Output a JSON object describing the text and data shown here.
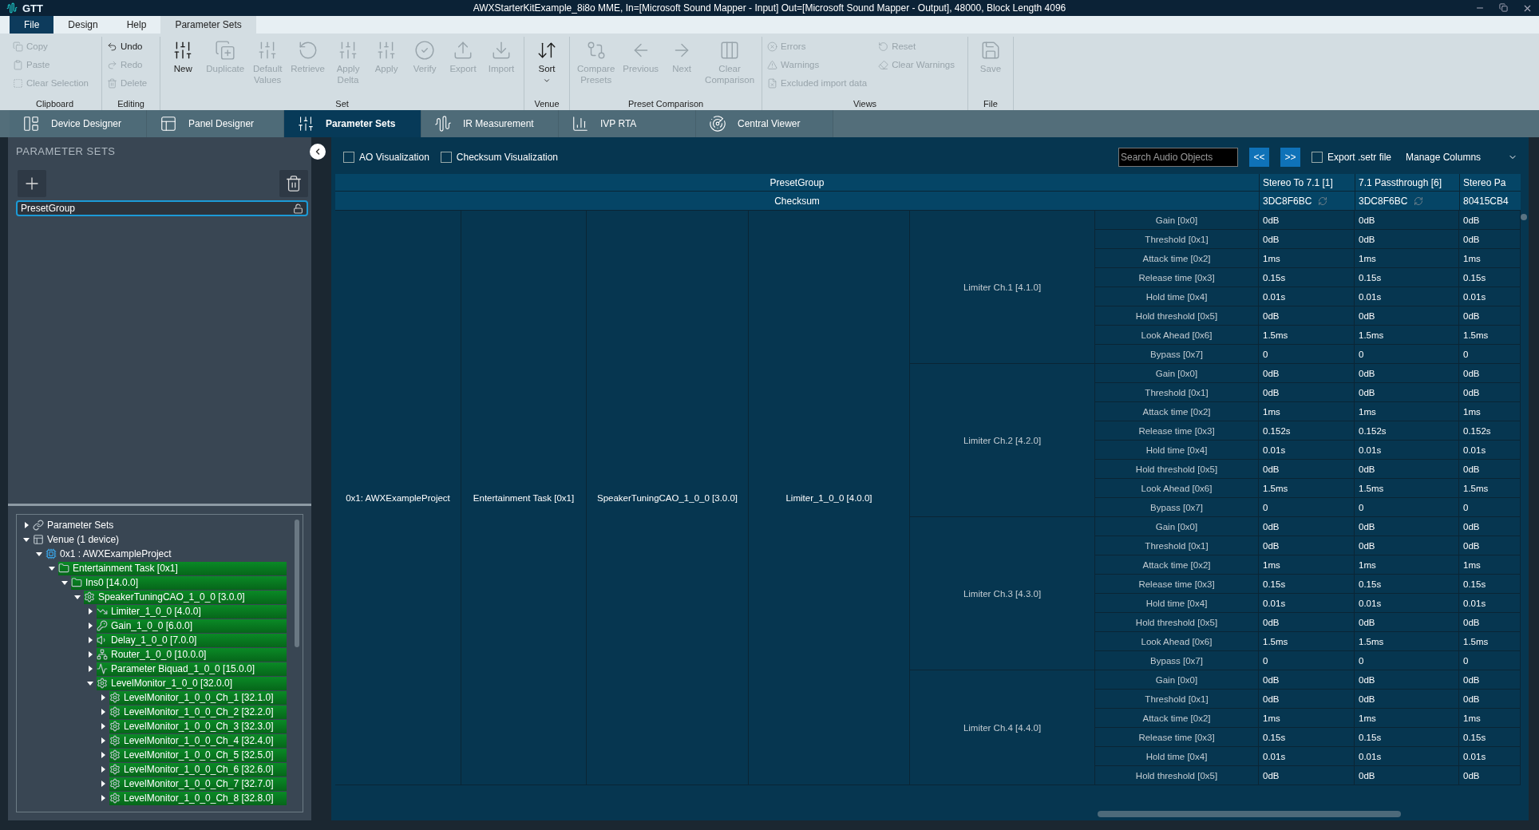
{
  "app_name": "GTT",
  "window": {
    "title": "AWXStarterKitExample_8i8o MME, In=[Microsoft Sound Mapper - Input] Out=[Microsoft Sound Mapper - Output], 48000, Block Length 4096"
  },
  "file_button": "File",
  "menu_tabs": [
    {
      "label": "Design",
      "selected": false
    },
    {
      "label": "Help",
      "selected": false
    },
    {
      "label": "Parameter Sets",
      "selected": true
    }
  ],
  "ribbon_groups": [
    {
      "label": "Clipboard",
      "columns": [
        [
          {
            "label": "Copy",
            "disabled": true
          },
          {
            "label": "Paste",
            "disabled": true
          },
          {
            "label": "Clear Selection",
            "disabled": true
          }
        ]
      ]
    },
    {
      "label": "Editing",
      "columns": [
        [
          {
            "label": "Undo",
            "disabled": false
          },
          {
            "label": "Redo",
            "disabled": true
          },
          {
            "label": "Delete",
            "disabled": true
          }
        ]
      ]
    },
    {
      "label": "Set",
      "items": [
        {
          "label": "New",
          "disabled": false
        },
        {
          "label": "Duplicate",
          "disabled": true
        },
        {
          "label": "Default\nValues",
          "disabled": true
        },
        {
          "label": "Retrieve",
          "disabled": true
        },
        {
          "label": "Apply\nDelta",
          "disabled": true
        },
        {
          "label": "Apply",
          "disabled": true
        },
        {
          "label": "Verify",
          "disabled": true
        },
        {
          "label": "Export",
          "disabled": true
        },
        {
          "label": "Import",
          "disabled": true
        }
      ]
    },
    {
      "label": "Venue",
      "items": [
        {
          "label": "Sort",
          "disabled": false,
          "dropdown": true
        }
      ]
    },
    {
      "label": "Preset Comparison",
      "items": [
        {
          "label": "Compare\nPresets",
          "disabled": true
        },
        {
          "label": "Previous",
          "disabled": true
        },
        {
          "label": "Next",
          "disabled": true
        },
        {
          "label": "Clear\nComparison",
          "disabled": true
        }
      ]
    },
    {
      "label": "Views",
      "columns": [
        [
          {
            "label": "Errors",
            "disabled": true
          },
          {
            "label": "Warnings",
            "disabled": true
          },
          {
            "label": "Excluded import data",
            "disabled": true
          }
        ],
        [
          {
            "label": "Reset",
            "disabled": true
          },
          {
            "label": "Clear Warnings",
            "disabled": true
          }
        ]
      ]
    },
    {
      "label": "File",
      "items": [
        {
          "label": "Save",
          "disabled": true
        }
      ]
    }
  ],
  "module_tabs": [
    {
      "label": "Device Designer",
      "selected": false
    },
    {
      "label": "Panel Designer",
      "selected": false
    },
    {
      "label": "Parameter Sets",
      "selected": true
    },
    {
      "label": "IR Measurement",
      "selected": false
    },
    {
      "label": "IVP RTA",
      "selected": false
    },
    {
      "label": "Central Viewer",
      "selected": false
    }
  ],
  "sidebar": {
    "title": "PARAMETER SETS",
    "sets": [
      {
        "label": "PresetGroup",
        "selected": true,
        "locked": false
      }
    ],
    "tree": [
      {
        "label": "Parameter Sets",
        "kind": "link",
        "expanded": false,
        "highlighted": false
      },
      {
        "label": "Venue (1 device)",
        "kind": "venue",
        "expanded": true,
        "highlighted": false,
        "children": [
          {
            "label": "0x1 : AWXExampleProject",
            "kind": "device",
            "expanded": true,
            "highlighted": false,
            "children": [
              {
                "label": "Entertainment Task [0x1]",
                "kind": "folder",
                "expanded": true,
                "highlighted": true,
                "children": [
                  {
                    "label": "Ins0 [14.0.0]",
                    "kind": "folder",
                    "expanded": true,
                    "highlighted": true,
                    "children": [
                      {
                        "label": "SpeakerTuningCAO_1_0_0 [3.0.0]",
                        "kind": "gear",
                        "expanded": true,
                        "highlighted": true,
                        "children": [
                          {
                            "label": "Limiter_1_0_0 [4.0.0]",
                            "kind": "limiter",
                            "expanded": false,
                            "highlighted": true
                          },
                          {
                            "label": "Gain_1_0_0 [6.0.0]",
                            "kind": "key",
                            "expanded": false,
                            "highlighted": true
                          },
                          {
                            "label": "Delay_1_0_0 [7.0.0]",
                            "kind": "speaker",
                            "expanded": false,
                            "highlighted": true
                          },
                          {
                            "label": "Router_1_0_0 [10.0.0]",
                            "kind": "router",
                            "expanded": false,
                            "highlighted": true
                          },
                          {
                            "label": "Parameter Biquad_1_0_0 [15.0.0]",
                            "kind": "biquad",
                            "expanded": false,
                            "highlighted": true
                          },
                          {
                            "label": "LevelMonitor_1_0_0 [32.0.0]",
                            "kind": "gear",
                            "expanded": true,
                            "highlighted": true,
                            "children": [
                              {
                                "label": "LevelMonitor_1_0_0_Ch_1 [32.1.0]",
                                "kind": "gear",
                                "expanded": false,
                                "highlighted": true
                              },
                              {
                                "label": "LevelMonitor_1_0_0_Ch_2 [32.2.0]",
                                "kind": "gear",
                                "expanded": false,
                                "highlighted": true
                              },
                              {
                                "label": "LevelMonitor_1_0_0_Ch_3 [32.3.0]",
                                "kind": "gear",
                                "expanded": false,
                                "highlighted": true
                              },
                              {
                                "label": "LevelMonitor_1_0_0_Ch_4 [32.4.0]",
                                "kind": "gear",
                                "expanded": false,
                                "highlighted": true
                              },
                              {
                                "label": "LevelMonitor_1_0_0_Ch_5 [32.5.0]",
                                "kind": "gear",
                                "expanded": false,
                                "highlighted": true
                              },
                              {
                                "label": "LevelMonitor_1_0_0_Ch_6 [32.6.0]",
                                "kind": "gear",
                                "expanded": false,
                                "highlighted": true
                              },
                              {
                                "label": "LevelMonitor_1_0_0_Ch_7 [32.7.0]",
                                "kind": "gear",
                                "expanded": false,
                                "highlighted": true
                              },
                              {
                                "label": "LevelMonitor_1_0_0_Ch_8 [32.8.0]",
                                "kind": "gear",
                                "expanded": false,
                                "highlighted": true
                              }
                            ]
                          }
                        ]
                      }
                    ]
                  }
                ]
              }
            ]
          }
        ]
      }
    ]
  },
  "toolbar": {
    "checkboxes": [
      {
        "label": "AO Visualization",
        "checked": false
      },
      {
        "label": "Checksum Visualization",
        "checked": false
      }
    ],
    "search": {
      "placeholder": "Search Audio Objects"
    },
    "prev_button": "<<",
    "next_button": ">>",
    "export_checkbox": {
      "label": "Export .setr file",
      "checked": false
    },
    "columns_dropdown": "Manage Columns"
  },
  "table": {
    "group_header": "PresetGroup",
    "checksum_header": "Checksum",
    "columns": [
      {
        "name": "Stereo To 7.1 [1]",
        "checksum": "3DC8F6BC",
        "sync_icon": true
      },
      {
        "name": "7.1 Passthrough [6]",
        "checksum": "3DC8F6BC",
        "sync_icon": true
      },
      {
        "name": "Stereo Pa",
        "checksum": "80415CB4",
        "sync_icon": false
      }
    ],
    "path": [
      "0x1: AWXExampleProject",
      "Entertainment Task [0x1]",
      "SpeakerTuningCAO_1_0_0 [3.0.0]",
      "Limiter_1_0_0 [4.0.0]"
    ],
    "groups": [
      {
        "label": "Limiter Ch.1 [4.1.0]",
        "rows": [
          {
            "param": "Gain [0x0]",
            "values": [
              "0dB",
              "0dB",
              "0dB"
            ]
          },
          {
            "param": "Threshold [0x1]",
            "values": [
              "0dB",
              "0dB",
              "0dB"
            ]
          },
          {
            "param": "Attack time [0x2]",
            "values": [
              "1ms",
              "1ms",
              "1ms"
            ]
          },
          {
            "param": "Release time [0x3]",
            "values": [
              "0.15s",
              "0.15s",
              "0.15s"
            ]
          },
          {
            "param": "Hold time [0x4]",
            "values": [
              "0.01s",
              "0.01s",
              "0.01s"
            ]
          },
          {
            "param": "Hold threshold [0x5]",
            "values": [
              "0dB",
              "0dB",
              "0dB"
            ]
          },
          {
            "param": "Look Ahead [0x6]",
            "values": [
              "1.5ms",
              "1.5ms",
              "1.5ms"
            ]
          },
          {
            "param": "Bypass [0x7]",
            "values": [
              "0",
              "0",
              "0"
            ]
          }
        ]
      },
      {
        "label": "Limiter Ch.2 [4.2.0]",
        "rows": [
          {
            "param": "Gain [0x0]",
            "values": [
              "0dB",
              "0dB",
              "0dB"
            ]
          },
          {
            "param": "Threshold [0x1]",
            "values": [
              "0dB",
              "0dB",
              "0dB"
            ]
          },
          {
            "param": "Attack time [0x2]",
            "values": [
              "1ms",
              "1ms",
              "1ms"
            ]
          },
          {
            "param": "Release time [0x3]",
            "values": [
              "0.152s",
              "0.152s",
              "0.152s"
            ]
          },
          {
            "param": "Hold time [0x4]",
            "values": [
              "0.01s",
              "0.01s",
              "0.01s"
            ]
          },
          {
            "param": "Hold threshold [0x5]",
            "values": [
              "0dB",
              "0dB",
              "0dB"
            ]
          },
          {
            "param": "Look Ahead [0x6]",
            "values": [
              "1.5ms",
              "1.5ms",
              "1.5ms"
            ]
          },
          {
            "param": "Bypass [0x7]",
            "values": [
              "0",
              "0",
              "0"
            ]
          }
        ]
      },
      {
        "label": "Limiter Ch.3 [4.3.0]",
        "rows": [
          {
            "param": "Gain [0x0]",
            "values": [
              "0dB",
              "0dB",
              "0dB"
            ]
          },
          {
            "param": "Threshold [0x1]",
            "values": [
              "0dB",
              "0dB",
              "0dB"
            ]
          },
          {
            "param": "Attack time [0x2]",
            "values": [
              "1ms",
              "1ms",
              "1ms"
            ]
          },
          {
            "param": "Release time [0x3]",
            "values": [
              "0.15s",
              "0.15s",
              "0.15s"
            ]
          },
          {
            "param": "Hold time [0x4]",
            "values": [
              "0.01s",
              "0.01s",
              "0.01s"
            ]
          },
          {
            "param": "Hold threshold [0x5]",
            "values": [
              "0dB",
              "0dB",
              "0dB"
            ]
          },
          {
            "param": "Look Ahead [0x6]",
            "values": [
              "1.5ms",
              "1.5ms",
              "1.5ms"
            ]
          },
          {
            "param": "Bypass [0x7]",
            "values": [
              "0",
              "0",
              "0"
            ]
          }
        ]
      },
      {
        "label": "Limiter Ch.4 [4.4.0]",
        "rows": [
          {
            "param": "Gain [0x0]",
            "values": [
              "0dB",
              "0dB",
              "0dB"
            ]
          },
          {
            "param": "Threshold [0x1]",
            "values": [
              "0dB",
              "0dB",
              "0dB"
            ]
          },
          {
            "param": "Attack time [0x2]",
            "values": [
              "1ms",
              "1ms",
              "1ms"
            ]
          },
          {
            "param": "Release time [0x3]",
            "values": [
              "0.15s",
              "0.15s",
              "0.15s"
            ]
          },
          {
            "param": "Hold time [0x4]",
            "values": [
              "0.01s",
              "0.01s",
              "0.01s"
            ]
          },
          {
            "param": "Hold threshold [0x5]",
            "values": [
              "0dB",
              "0dB",
              "0dB"
            ]
          }
        ]
      }
    ]
  }
}
